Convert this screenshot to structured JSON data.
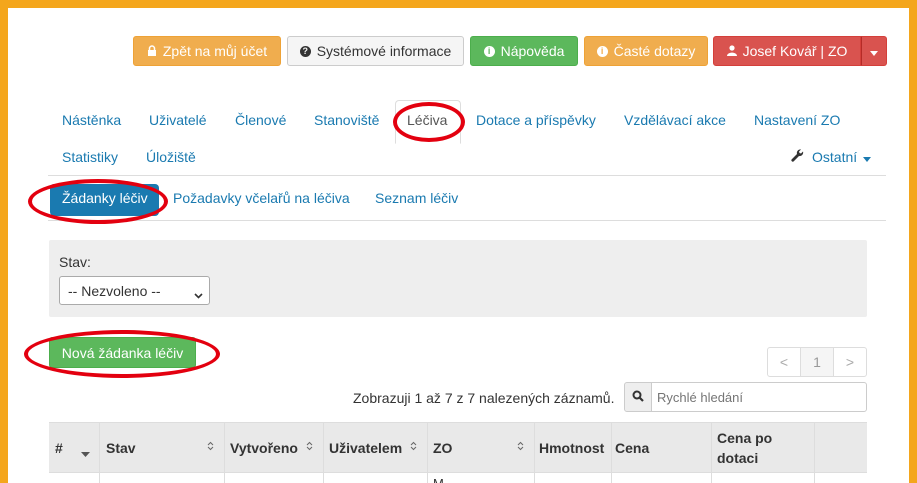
{
  "topbar": {
    "back_label": "Zpět na můj účet",
    "sysinfo_label": "Systémové informace",
    "help_label": "Nápověda",
    "faq_label": "Časté dotazy",
    "user_label": "Josef Kovář | ZO"
  },
  "nav": {
    "tabs": [
      "Nástěnka",
      "Uživatelé",
      "Členové",
      "Stanoviště",
      "Léčiva",
      "Dotace a příspěvky",
      "Vzdělávací akce",
      "Nastavení ZO",
      "Statistiky",
      "Úložiště"
    ],
    "other_label": "Ostatní",
    "active_tab": "Léčiva"
  },
  "subnav": {
    "tabs": [
      "Žádanky léčiv",
      "Požadavky včelařů na léčiva",
      "Seznam léčiv"
    ],
    "active_tab": "Žádanky léčiv"
  },
  "filter": {
    "state_label": "Stav:",
    "state_value": "-- Nezvoleno --"
  },
  "actions": {
    "new_request_label": "Nová žádanka léčiv"
  },
  "pagination": {
    "prev": "<",
    "page": "1",
    "next": ">"
  },
  "results": {
    "summary": "Zobrazuji 1 až 7 z 7 nalezených záznamů.",
    "search_placeholder": "Rychlé hledání"
  },
  "table": {
    "headers": [
      "#",
      "Stav",
      "Vytvořeno",
      "Uživatelem",
      "ZO",
      "Hmotnost",
      "Cena",
      "Cena po",
      "dotaci"
    ],
    "first_row_partial": "M"
  },
  "colors": {
    "frame": "#f4a61c",
    "link": "#1a7ab0",
    "active_pill": "#1a7ab0",
    "highlight": "#e3000f"
  }
}
